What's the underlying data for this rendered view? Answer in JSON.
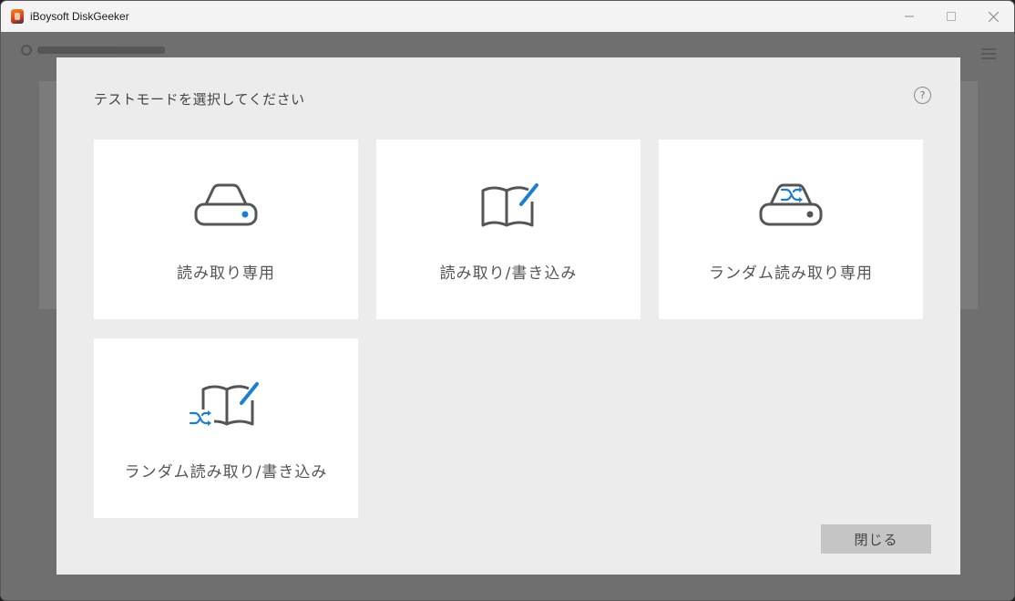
{
  "window": {
    "title": "iBoysoft DiskGeeker",
    "controls": [
      "minimize-icon",
      "maximize-icon",
      "close-icon"
    ]
  },
  "dialog": {
    "title": "テストモードを選択してください",
    "help_label": "?",
    "cards": [
      {
        "label": "読み取り専用",
        "icon": "drive-icon"
      },
      {
        "label": "読み取り/書き込み",
        "icon": "book-pen-icon"
      },
      {
        "label": "ランダム読み取り専用",
        "icon": "drive-shuffle-icon"
      },
      {
        "label": "ランダム読み取り/書き込み",
        "icon": "book-pen-shuffle-icon"
      }
    ],
    "close_label": "閉じる"
  },
  "colors": {
    "accent": "#1a7fd4",
    "icon_stroke": "#555555",
    "card_bg": "#ffffff",
    "dialog_bg": "#ececec",
    "button_bg": "#c5c5c5"
  }
}
